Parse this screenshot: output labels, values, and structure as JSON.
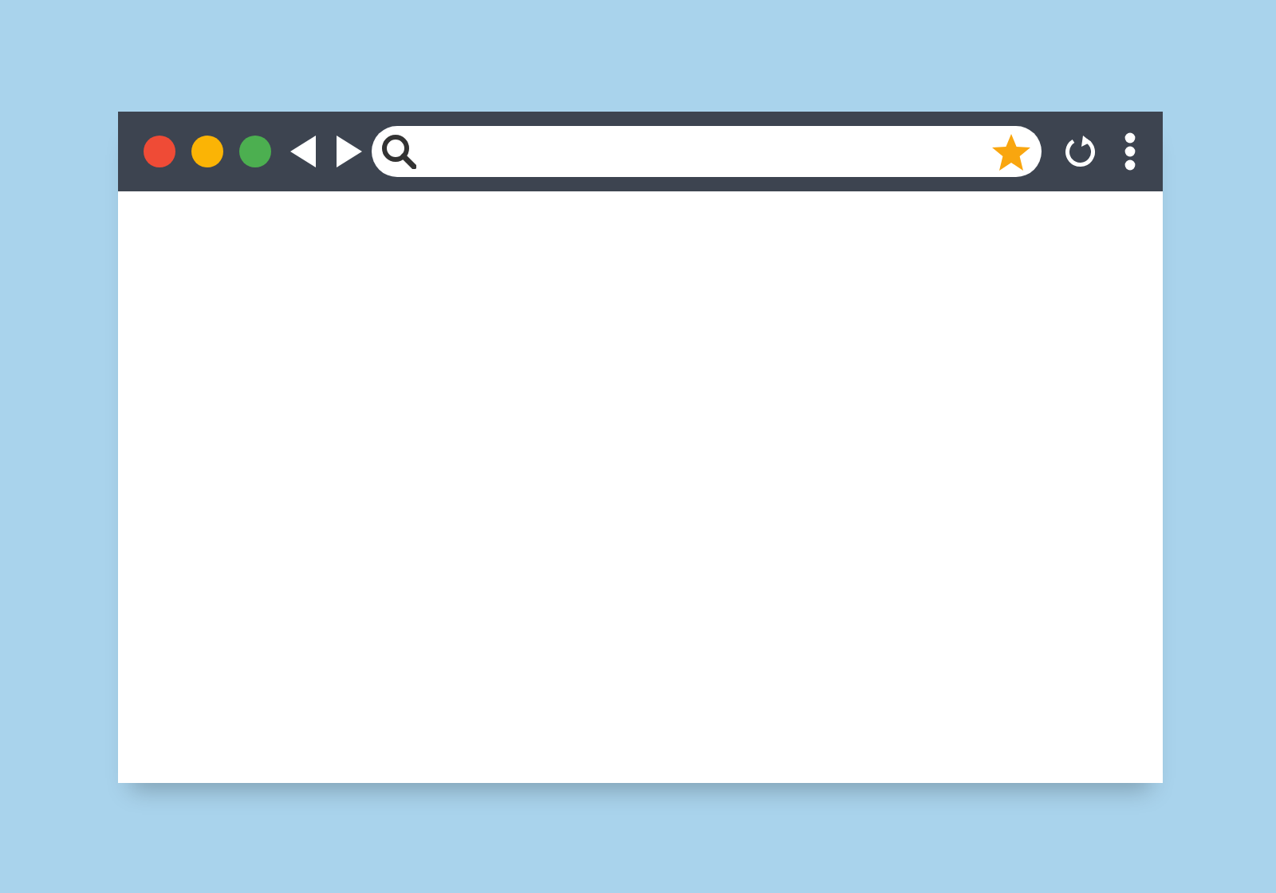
{
  "window_controls": [
    {
      "color": "#ef4b36"
    },
    {
      "color": "#fbb405"
    },
    {
      "color": "#4caf50"
    }
  ],
  "address_bar": {
    "bookmarked": true
  }
}
